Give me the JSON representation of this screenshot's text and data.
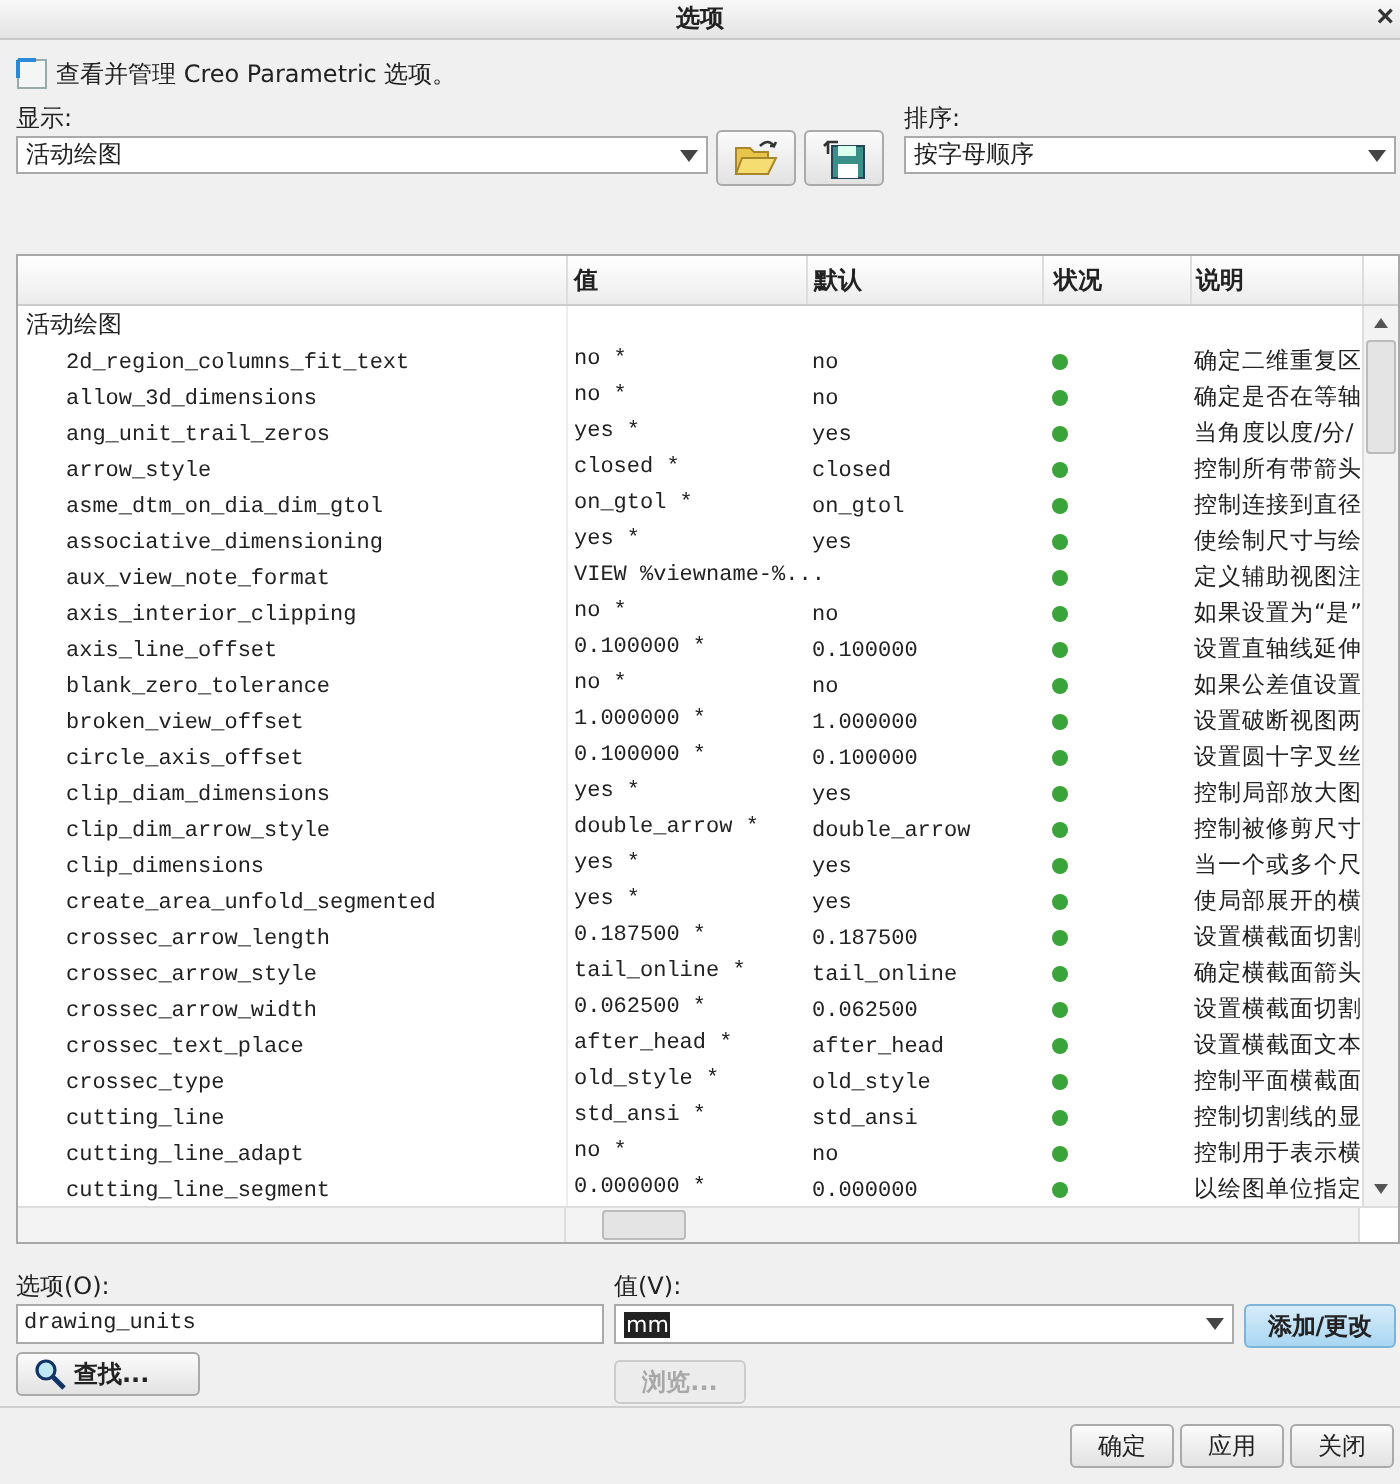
{
  "window": {
    "title": "选项",
    "close": "×"
  },
  "intro": "查看并管理 Creo Parametric 选项。",
  "show": {
    "label": "显示:",
    "value": "活动绘图"
  },
  "sort": {
    "label": "排序:",
    "value": "按字母顺序"
  },
  "table": {
    "columns": [
      "值",
      "默认",
      "状况",
      "说明"
    ],
    "group": "活动绘图",
    "rows": [
      {
        "name": "2d_region_columns_fit_text",
        "value": "no *",
        "default": "no",
        "color": "#3aa33a",
        "description": "确定二维重复区"
      },
      {
        "name": "allow_3d_dimensions",
        "value": "no *",
        "default": "no",
        "color": "#3aa33a",
        "description": "确定是否在等轴"
      },
      {
        "name": "ang_unit_trail_zeros",
        "value": "yes *",
        "default": "yes",
        "color": "#3aa33a",
        "description": "当角度以度/分/"
      },
      {
        "name": "arrow_style",
        "value": "closed *",
        "default": "closed",
        "color": "#3aa33a",
        "description": "控制所有带箭头"
      },
      {
        "name": "asme_dtm_on_dia_dim_gtol",
        "value": "on_gtol *",
        "default": "on_gtol",
        "color": "#3aa33a",
        "description": "控制连接到直径"
      },
      {
        "name": "associative_dimensioning",
        "value": "yes *",
        "default": "yes",
        "color": "#3aa33a",
        "description": "使绘制尺寸与绘"
      },
      {
        "name": "aux_view_note_format",
        "value": "VIEW %viewname-%...",
        "default": "",
        "color": "#3aa33a",
        "description": "定义辅助视图注"
      },
      {
        "name": "axis_interior_clipping",
        "value": "no *",
        "default": "no",
        "color": "#3aa33a",
        "description": "如果设置为“是”"
      },
      {
        "name": "axis_line_offset",
        "value": "0.100000 *",
        "default": "0.100000",
        "color": "#3aa33a",
        "description": "设置直轴线延伸"
      },
      {
        "name": "blank_zero_tolerance",
        "value": "no *",
        "default": "no",
        "color": "#3aa33a",
        "description": "如果公差值设置"
      },
      {
        "name": "broken_view_offset",
        "value": "1.000000 *",
        "default": "1.000000",
        "color": "#3aa33a",
        "description": "设置破断视图两"
      },
      {
        "name": "circle_axis_offset",
        "value": "0.100000 *",
        "default": "0.100000",
        "color": "#3aa33a",
        "description": "设置圆十字叉丝"
      },
      {
        "name": "clip_diam_dimensions",
        "value": "yes *",
        "default": "yes",
        "color": "#3aa33a",
        "description": "控制局部放大图"
      },
      {
        "name": "clip_dim_arrow_style",
        "value": "double_arrow *",
        "default": "double_arrow",
        "color": "#3aa33a",
        "description": "控制被修剪尺寸"
      },
      {
        "name": "clip_dimensions",
        "value": "yes *",
        "default": "yes",
        "color": "#3aa33a",
        "description": "当一个或多个尺"
      },
      {
        "name": "create_area_unfold_segmented",
        "value": "yes *",
        "default": "yes",
        "color": "#3aa33a",
        "description": "使局部展开的横"
      },
      {
        "name": "crossec_arrow_length",
        "value": "0.187500 *",
        "default": "0.187500",
        "color": "#3aa33a",
        "description": "设置横截面切割"
      },
      {
        "name": "crossec_arrow_style",
        "value": "tail_online *",
        "default": "tail_online",
        "color": "#3aa33a",
        "description": "确定横截面箭头"
      },
      {
        "name": "crossec_arrow_width",
        "value": "0.062500 *",
        "default": "0.062500",
        "color": "#3aa33a",
        "description": "设置横截面切割"
      },
      {
        "name": "crossec_text_place",
        "value": "after_head *",
        "default": "after_head",
        "color": "#3aa33a",
        "description": "设置横截面文本"
      },
      {
        "name": "crossec_type",
        "value": "old_style *",
        "default": "old_style",
        "color": "#3aa33a",
        "description": "控制平面横截面"
      },
      {
        "name": "cutting_line",
        "value": "std_ansi *",
        "default": "std_ansi",
        "color": "#3aa33a",
        "description": "控制切割线的显"
      },
      {
        "name": "cutting_line_adapt",
        "value": "no *",
        "default": "no",
        "color": "#3aa33a",
        "description": "控制用于表示横"
      },
      {
        "name": "cutting_line_segment",
        "value": "0.000000 *",
        "default": "0.000000",
        "color": "#3aa33a",
        "description": "以绘图单位指定"
      }
    ]
  },
  "option": {
    "label": "选项(O):",
    "value": "drawing_units"
  },
  "value_field": {
    "label": "值(V):",
    "value": "mm"
  },
  "buttons": {
    "add": {
      "label": "添加/更改",
      "disabled": false
    },
    "find": {
      "label": "查找...",
      "disabled": false
    },
    "browse": {
      "label": "浏览...",
      "disabled": true
    }
  },
  "footer": [
    {
      "label": "确定",
      "disabled": false
    },
    {
      "label": "应用",
      "disabled": false
    },
    {
      "label": "关闭",
      "disabled": false
    }
  ]
}
